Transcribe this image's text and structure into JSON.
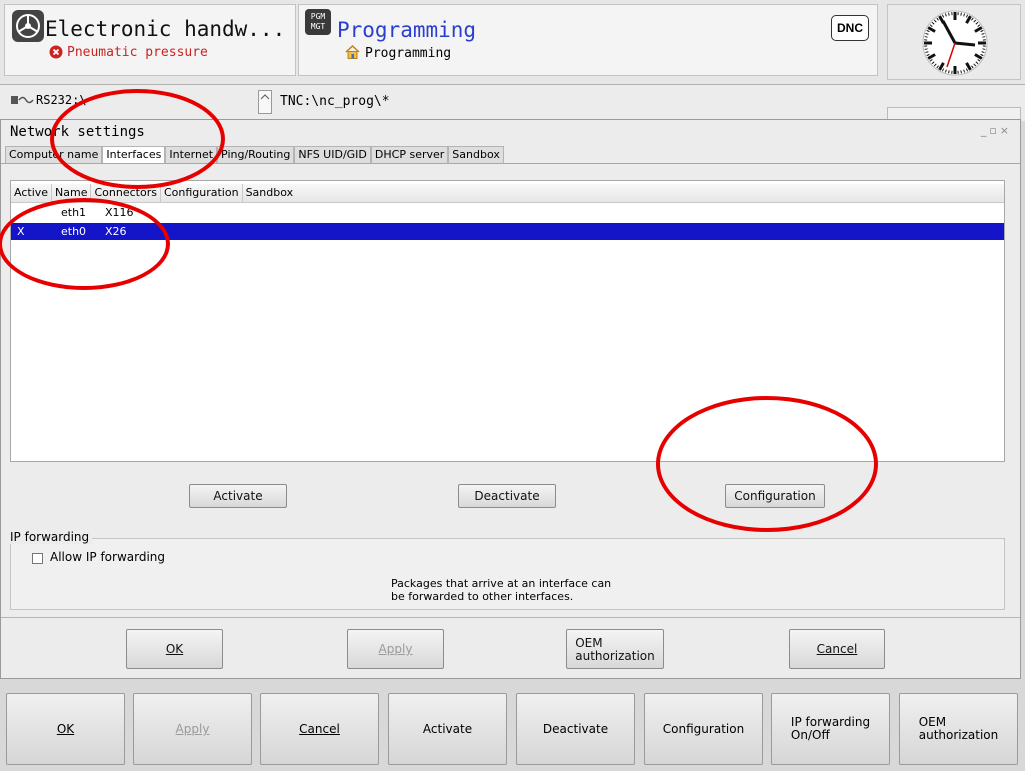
{
  "header": {
    "machine_mode": {
      "title": "Electronic handw...",
      "status": "Pneumatic pressure"
    },
    "program_mode": {
      "badge": "PGM\nMGT",
      "title": "Programming",
      "subtitle": "Programming"
    },
    "dnc_badge": "DNC"
  },
  "path_row": {
    "interface": "RS232:\\",
    "path": "TNC:\\nc_prog\\*"
  },
  "dialog": {
    "title": "Network settings",
    "tabs": [
      "Computer name",
      "Interfaces",
      "Internet",
      "Ping/Routing",
      "NFS UID/GID",
      "DHCP server",
      "Sandbox"
    ],
    "active_tab": "Interfaces",
    "table": {
      "columns": [
        "Active",
        "Name",
        "Connectors",
        "Configuration",
        "Sandbox"
      ],
      "rows": [
        {
          "active": "",
          "name": "eth1",
          "connector": "X116",
          "selected": false
        },
        {
          "active": "X",
          "name": "eth0",
          "connector": "X26",
          "selected": true
        }
      ]
    },
    "table_buttons": {
      "activate": "Activate",
      "deactivate": "Deactivate",
      "configuration": "Configuration"
    },
    "ip_forwarding": {
      "group_label": "IP forwarding",
      "checkbox_label": "Allow IP forwarding",
      "checked": false,
      "description_line1": "Packages that arrive at an interface can",
      "description_line2": "be forwarded to other interfaces."
    },
    "footer": {
      "ok": "OK",
      "apply": "Apply",
      "oem_line1": "OEM",
      "oem_line2": "authorization",
      "cancel": "Cancel"
    }
  },
  "softkeys": {
    "ok": "OK",
    "apply": "Apply",
    "cancel": "Cancel",
    "activate": "Activate",
    "deactivate": "Deactivate",
    "configuration": "Configuration",
    "ipf_line1": "IP forwarding",
    "ipf_line2": "On/Off",
    "oem_line1": "OEM",
    "oem_line2": "authorization"
  },
  "colors": {
    "selection": "#1414c8",
    "annotation": "#e60000",
    "program_title": "#2a3fd0",
    "status_red": "#cc2222"
  }
}
